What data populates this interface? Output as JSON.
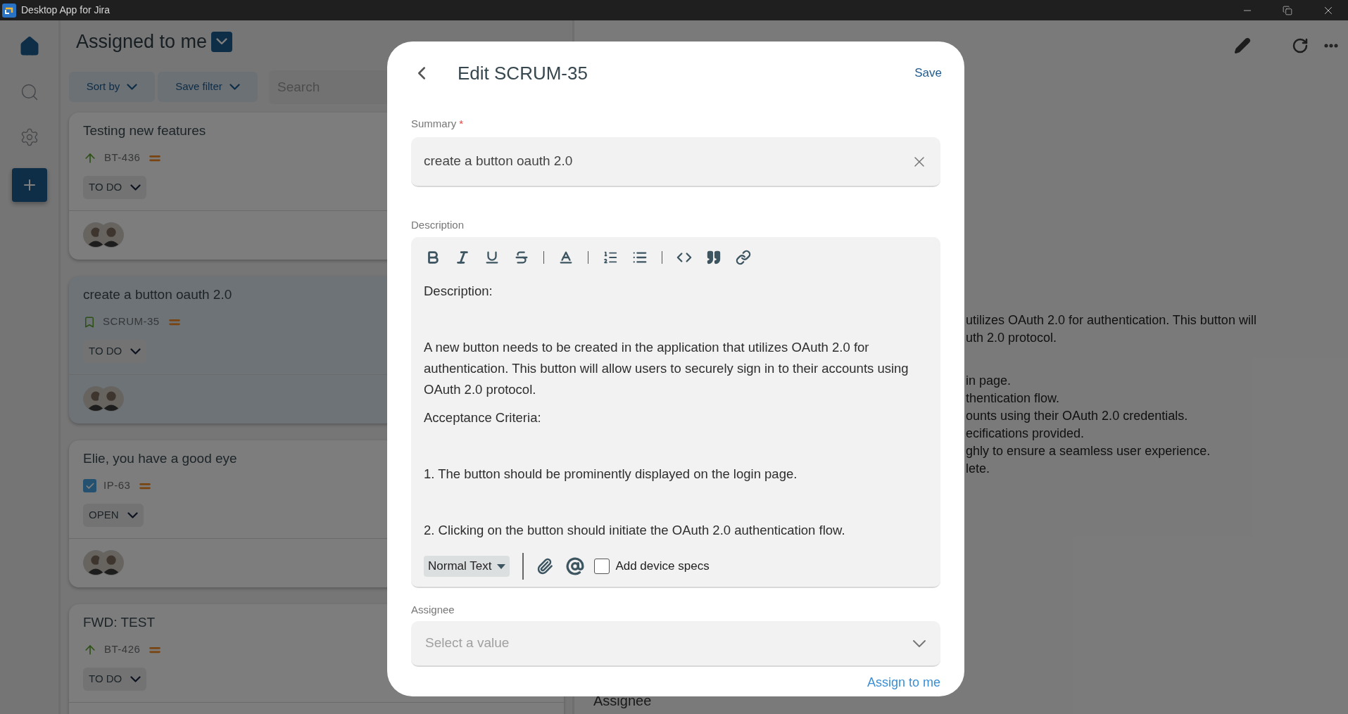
{
  "window": {
    "title": "Desktop App for Jira"
  },
  "sidebar": {
    "items": [
      {
        "kind": "home",
        "selected": true
      },
      {
        "kind": "search",
        "selected": false
      },
      {
        "kind": "settings",
        "selected": false
      }
    ]
  },
  "issue_list": {
    "title": "Assigned to me",
    "sort_button": "Sort by",
    "filter_button": "Save filter",
    "search": {
      "placeholder": "Search"
    },
    "issues": [
      {
        "title": "Testing new features",
        "type_icon": {
          "kind": "improvement"
        },
        "key": "BT-436",
        "priority_icon": {
          "kind": "medium"
        },
        "status": "TO DO",
        "selected": false,
        "assignees": [
          {
            "kind": "avatar"
          },
          {
            "kind": "avatar"
          }
        ]
      },
      {
        "title": "create a button oauth 2.0",
        "type_icon": {
          "kind": "story"
        },
        "key": "SCRUM-35",
        "priority_icon": {
          "kind": "medium"
        },
        "status": "TO DO",
        "selected": true,
        "assignees": [
          {
            "kind": "avatar"
          },
          {
            "kind": "avatar"
          }
        ]
      },
      {
        "title": "Elie, you have a good eye",
        "type_icon": {
          "kind": "task"
        },
        "key": "IP-63",
        "priority_icon": {
          "kind": "medium"
        },
        "status": "OPEN",
        "selected": false,
        "assignees": [
          {
            "kind": "avatar"
          },
          {
            "kind": "avatar"
          }
        ]
      },
      {
        "title": "FWD: TEST",
        "type_icon": {
          "kind": "improvement"
        },
        "key": "BT-426",
        "priority_icon": {
          "kind": "medium"
        },
        "status": "TO DO",
        "selected": false
      }
    ]
  },
  "detail": {
    "lines": [
      {
        "kind": "text",
        "text": "utilizes OAuth 2.0 for authentication. This button will"
      },
      {
        "kind": "text",
        "text": "uth 2.0 protocol."
      },
      {
        "kind": "empty"
      },
      {
        "kind": "text",
        "text": "in page."
      },
      {
        "kind": "text",
        "text": "thentication flow."
      },
      {
        "kind": "text",
        "text": "ounts using their OAuth 2.0 credentials."
      },
      {
        "kind": "text",
        "text": "ecifications provided."
      },
      {
        "kind": "text",
        "text": "ghly to ensure a seamless user experience."
      },
      {
        "kind": "text",
        "text": "lete."
      }
    ],
    "assignee_label": "Assignee"
  },
  "dialog": {
    "title": "Edit SCRUM-35",
    "save": "Save",
    "summary": {
      "label": "Summary",
      "required_mark": "*",
      "value": "create a button oauth 2.0"
    },
    "description": {
      "label": "Description",
      "content": [
        {
          "kind": "paragraph",
          "text": "Description:"
        },
        {
          "kind": "empty"
        },
        {
          "kind": "paragraph",
          "text": "A new button needs to be created in the application that utilizes OAuth 2.0 for authentication. This button will allow users to securely sign in to their accounts using OAuth 2.0 protocol."
        },
        {
          "kind": "paragraph",
          "text": "Acceptance Criteria:"
        },
        {
          "kind": "empty"
        },
        {
          "kind": "paragraph",
          "text": "1. The button should be prominently displayed on the login page."
        },
        {
          "kind": "empty"
        },
        {
          "kind": "paragraph",
          "text": "2. Clicking on the button should initiate the OAuth 2.0 authentication flow."
        }
      ],
      "text_style": "Normal Text",
      "device_specs": {
        "label": "Add device specs",
        "checked": false
      }
    },
    "assignee": {
      "label": "Assignee",
      "placeholder": "Select a value",
      "assign_to_me": "Assign to me"
    }
  }
}
